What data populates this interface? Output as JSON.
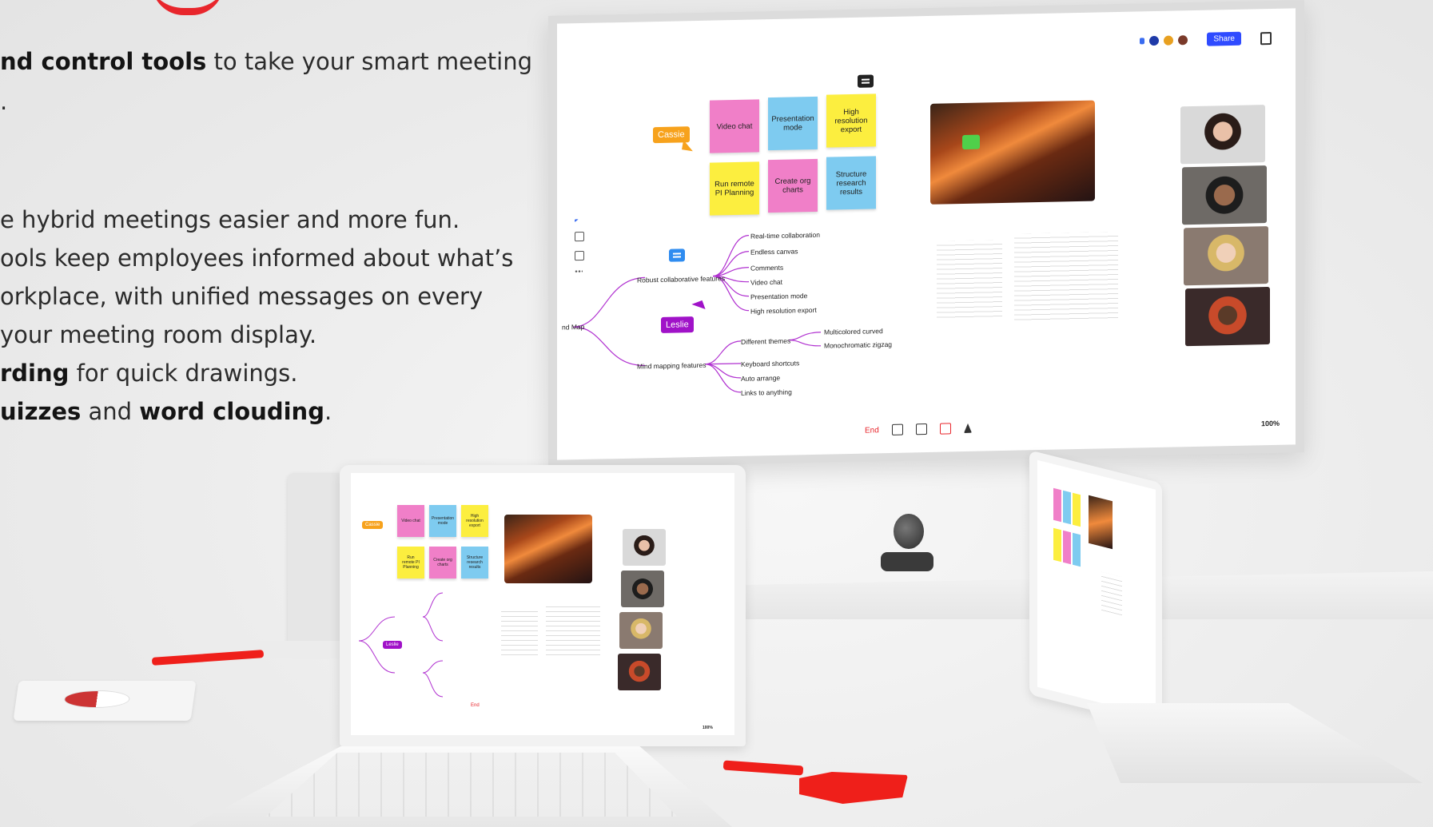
{
  "intro": {
    "line1_bold": "nd control tools",
    "line1_rest": " to take your smart meeting",
    "line2": "."
  },
  "bullets": {
    "b1": "e hybrid meetings easier and more fun.",
    "b2": "ools keep employees informed about what’s",
    "b3": "orkplace, with unified messages on every",
    "b4": "your meeting room display.",
    "b5_bold": "rding",
    "b5_rest": " for quick drawings.",
    "b6_bold1": "uizzes",
    "b6_mid": " and ",
    "b6_bold2": "word clouding",
    "b6_end": "."
  },
  "whiteboard": {
    "share_label": "Share",
    "zoom": "100%",
    "end_label": "End",
    "cursors": {
      "cassie": "Cassie",
      "leslie": "Leslie"
    },
    "stickies": {
      "s1": "Video chat",
      "s2": "Presentation mode",
      "s3": "High resolution export",
      "s4": "Run remote PI Planning",
      "s5": "Create org charts",
      "s6": "Structure research results"
    },
    "mindmap": {
      "root": "nd Map",
      "branch1": "Robust collaborative features",
      "b1_items": [
        "Real-time collaboration",
        "Endless canvas",
        "Comments",
        "Video chat",
        "Presentation mode",
        "High resolution export"
      ],
      "branch2": "Mind mapping features",
      "b2_sub": "Different themes",
      "b2_sub_items": [
        "Multicolored curved",
        "Monochromatic zigzag"
      ],
      "b2_items": [
        "Keyboard shortcuts",
        "Auto arrange",
        "Links to anything"
      ]
    }
  },
  "colors": {
    "accent": "#e8262c",
    "share": "#2f4bff",
    "pink": "#f07fc8",
    "blue": "#7ecbf0",
    "yellow": "#fcee3f",
    "mindmap": "#b030d0"
  }
}
